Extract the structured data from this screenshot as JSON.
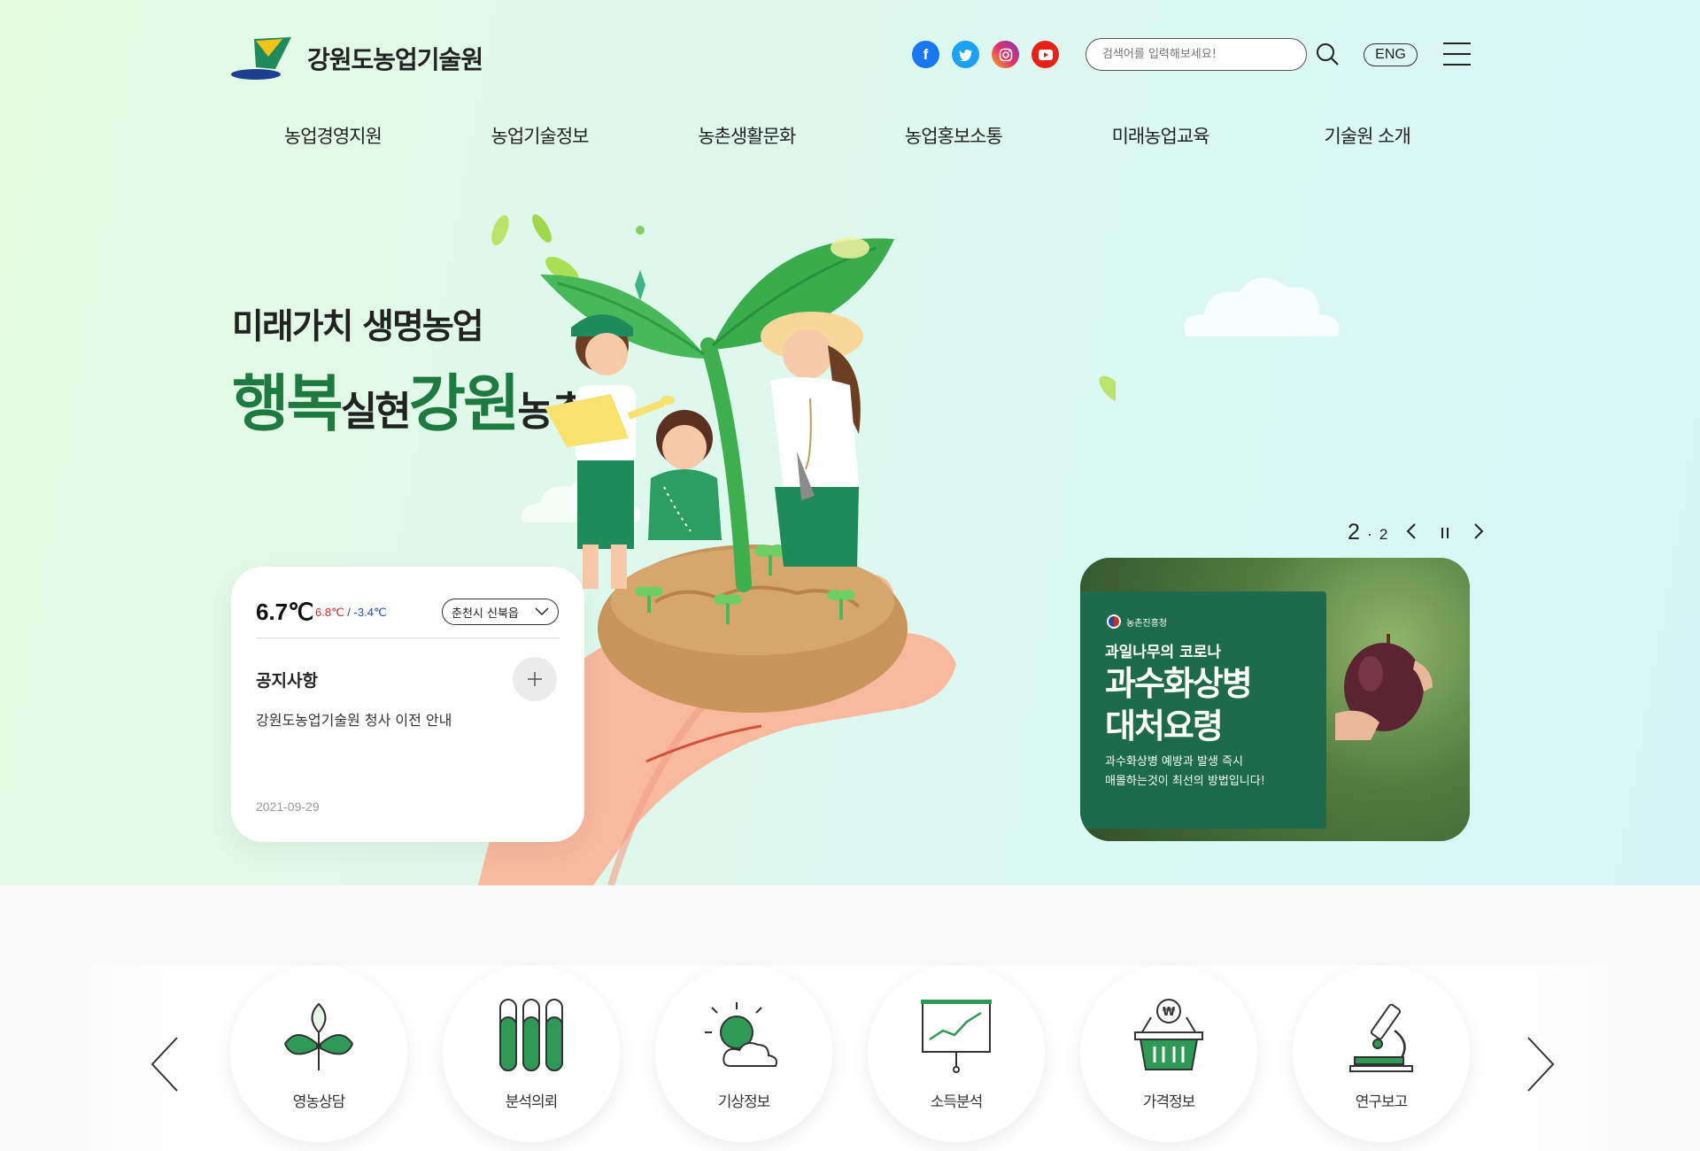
{
  "header": {
    "site_name": "강원도농업기술원",
    "search": {
      "placeholder": "검색어를 입력해보세요!"
    },
    "lang_button": "ENG",
    "social": [
      {
        "name": "facebook-icon",
        "label": "f",
        "color": "#1877f2"
      },
      {
        "name": "twitter-icon",
        "label": "t",
        "color": "#1da1f2"
      },
      {
        "name": "instagram-icon",
        "label": "◎",
        "color": "#d6249f"
      },
      {
        "name": "youtube-icon",
        "label": "▶",
        "color": "#e00"
      }
    ]
  },
  "nav": {
    "items": [
      "농업경영지원",
      "농업기술정보",
      "농촌생활문화",
      "농업홍보소통",
      "미래농업교육",
      "기술원 소개"
    ]
  },
  "hero": {
    "subtitle": "미래가치 생명농업",
    "title_parts": [
      "행복",
      "실현",
      "강원",
      "농촌"
    ]
  },
  "weather": {
    "temp": "6.7℃",
    "high": "6.8℃",
    "separator": "/",
    "low": "-3.4℃",
    "location": "춘천시 신북읍"
  },
  "notice": {
    "title": "공지사항",
    "item": "강원도농업기술원 청사 이전 안내",
    "date": "2021-09-29"
  },
  "slider": {
    "current": "2",
    "dot": "·",
    "total": "2"
  },
  "banner": {
    "agency": "농촌진흥청",
    "line1": "과일나무의 코로나",
    "headline1": "과수화상병",
    "headline2": "대처요령",
    "desc1": "과수화상병 예방과 발생 즉시",
    "desc2": "매몰하는것이 최선의 방법입니다!"
  },
  "quick_menu": [
    {
      "label": "영농상담",
      "icon": "plant-icon"
    },
    {
      "label": "분석의뢰",
      "icon": "test-tube-icon"
    },
    {
      "label": "기상정보",
      "icon": "weather-icon"
    },
    {
      "label": "소득분석",
      "icon": "chart-board-icon"
    },
    {
      "label": "가격정보",
      "icon": "basket-price-icon"
    },
    {
      "label": "연구보고",
      "icon": "microscope-icon"
    }
  ],
  "colors": {
    "brand_green": "#1f7a3f",
    "banner_green": "#1e6a4c",
    "temp_high": "#d62626",
    "temp_low": "#1e49b8"
  }
}
